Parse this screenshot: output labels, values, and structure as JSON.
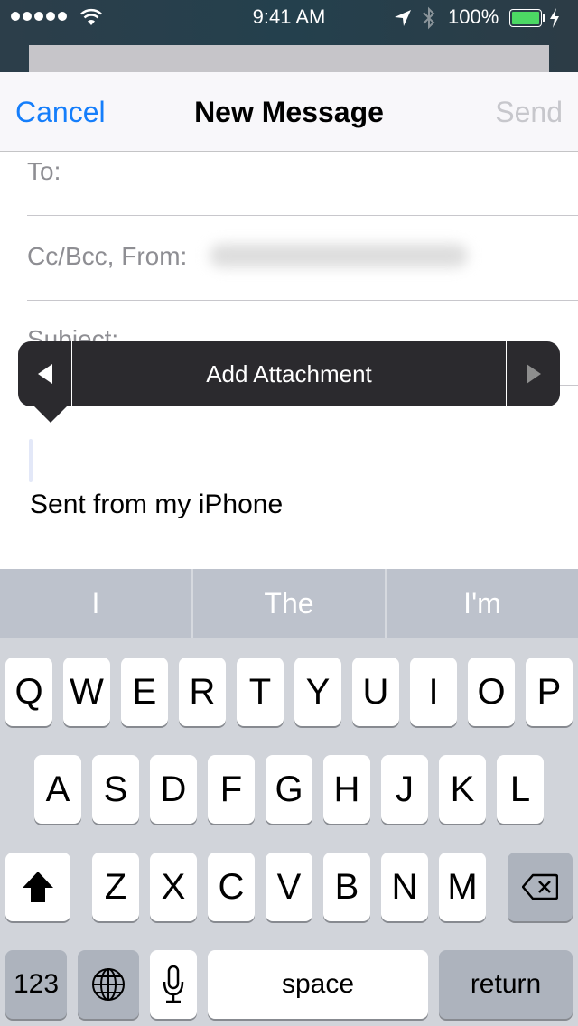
{
  "status_bar": {
    "signal_dots": 5,
    "time": "9:41 AM",
    "battery_percent": "100%",
    "battery_level": 1.0,
    "charging": true,
    "icons": [
      "signal-dots-icon",
      "wifi-icon",
      "location-arrow-icon",
      "bluetooth-icon",
      "battery-icon",
      "charging-bolt-icon"
    ]
  },
  "nav": {
    "cancel_label": "Cancel",
    "title": "New Message",
    "send_label": "Send"
  },
  "fields": {
    "to_label": "To:",
    "to_value": "",
    "ccbcc_label": "Cc/Bcc, From:",
    "from_value_blurred": true,
    "subject_label": "Subject:"
  },
  "body": {
    "signature": "Sent from my iPhone"
  },
  "callout": {
    "item_label": "Add Attachment",
    "prev_icon": "triangle-left-icon",
    "next_icon": "triangle-right-icon"
  },
  "keyboard": {
    "predictions": [
      "I",
      "The",
      "I'm"
    ],
    "row1": [
      "Q",
      "W",
      "E",
      "R",
      "T",
      "Y",
      "U",
      "I",
      "O",
      "P"
    ],
    "row2": [
      "A",
      "S",
      "D",
      "F",
      "G",
      "H",
      "J",
      "K",
      "L"
    ],
    "row3": [
      "Z",
      "X",
      "C",
      "V",
      "B",
      "N",
      "M"
    ],
    "numbers_label": "123",
    "space_label": "space",
    "return_label": "return",
    "shift_icon": "shift-arrow-icon",
    "delete_icon": "backspace-icon",
    "globe_icon": "globe-icon",
    "mic_icon": "microphone-icon"
  },
  "colors": {
    "accent": "#157efb",
    "disabled": "#c7c7cc",
    "battery_green": "#4cd964",
    "callout_bg": "#2b2a2e"
  }
}
